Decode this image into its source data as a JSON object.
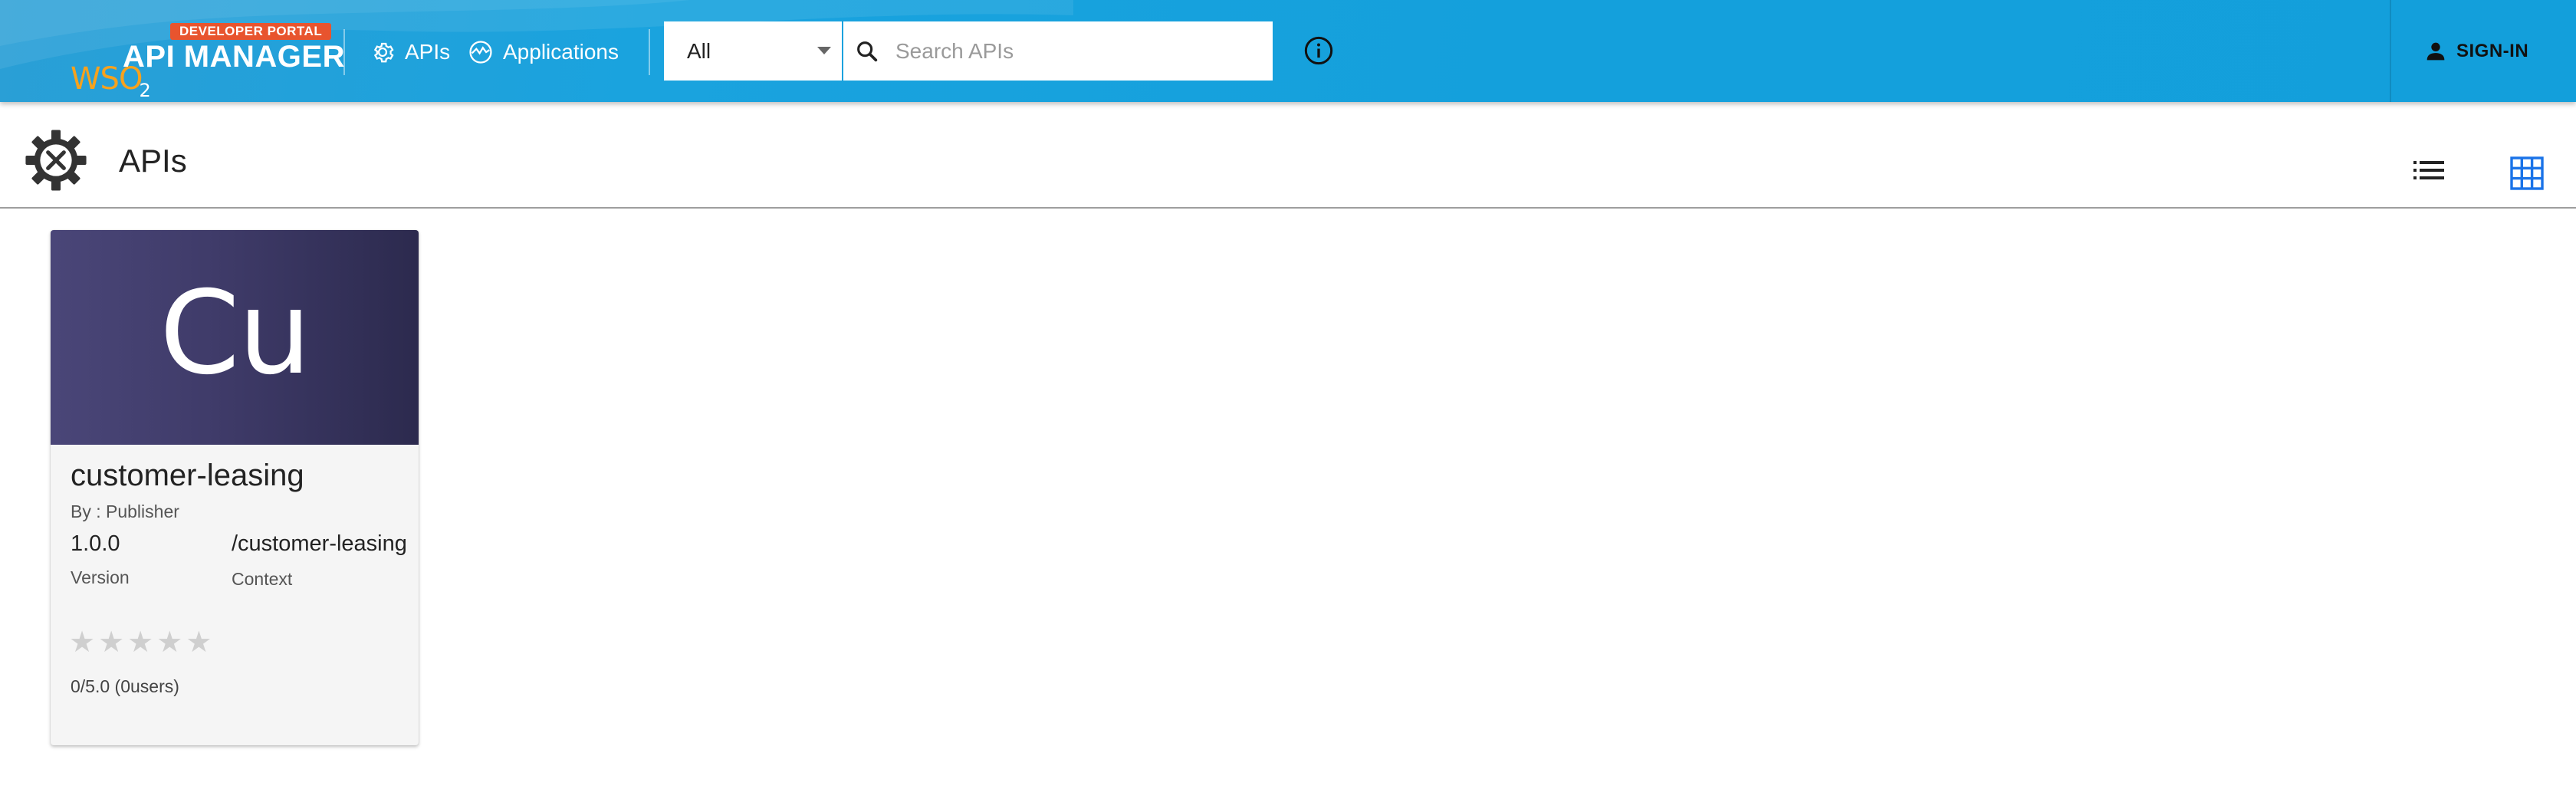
{
  "header": {
    "portal_badge": "DEVELOPER PORTAL",
    "logo_wso2": "WSO",
    "logo_sub": "2",
    "logo_product": "API MANAGER",
    "nav": [
      {
        "label": "APIs",
        "icon": "gear-icon"
      },
      {
        "label": "Applications",
        "icon": "applications-icon"
      }
    ],
    "filter_select": {
      "value": "All"
    },
    "search": {
      "placeholder": "Search APIs",
      "value": ""
    },
    "sign_in_label": "SIGN-IN",
    "colors": {
      "bar": "#14a0dc",
      "badge": "#e8542e",
      "logo_accent": "#f6a21e"
    }
  },
  "page": {
    "title": "APIs",
    "view_modes": [
      "list-view-icon",
      "grid-view-icon"
    ],
    "active_view": "grid"
  },
  "apis": [
    {
      "thumb_text": "Cu",
      "name": "customer-leasing",
      "by": "By : Publisher",
      "version": "1.0.0",
      "version_label": "Version",
      "context": "/customer-leasing",
      "context_label": "Context",
      "rating_stars": 0,
      "rating_text": "0/5.0 (0users)"
    }
  ]
}
